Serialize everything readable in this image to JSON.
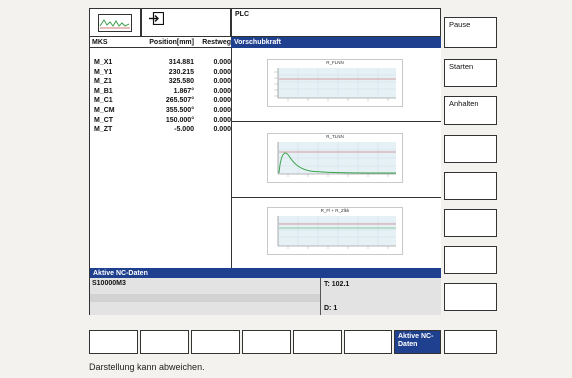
{
  "toolbar": {
    "wave_icon": "waveform-icon",
    "export_icon": "arrow-into-box-icon",
    "channel_label": "PLC"
  },
  "table": {
    "headers": [
      "MKS",
      "Position[mm]",
      "Restweg"
    ],
    "rows": [
      {
        "name": "M_X1",
        "position": "314.881",
        "rest": "0.000"
      },
      {
        "name": "M_Y1",
        "position": "230.215",
        "rest": "0.000"
      },
      {
        "name": "M_Z1",
        "position": "325.580",
        "rest": "0.000"
      },
      {
        "name": "M_B1",
        "position": "1.867°",
        "rest": "0.000"
      },
      {
        "name": "M_C1",
        "position": "265.507°",
        "rest": "0.000"
      },
      {
        "name": "M_CM",
        "position": "355.500°",
        "rest": "0.000"
      },
      {
        "name": "M_CT",
        "position": "150.000°",
        "rest": "0.000"
      },
      {
        "name": "M_ZT",
        "position": "-5.000",
        "rest": "0.000"
      }
    ]
  },
  "feed": {
    "header": "Vorschubkraft",
    "charts": [
      {
        "title": "R_FLNN"
      },
      {
        "title": "R_TLNN"
      },
      {
        "title": "R_Fl + R_Zlkk"
      }
    ]
  },
  "active_nc": {
    "header": "Aktive NC-Daten",
    "program": "S10000M3",
    "tool_label": "T: 102.1",
    "d_label": "D: 1"
  },
  "softkeys": {
    "right": [
      "Pause",
      "Starten",
      "Anhalten",
      "",
      "",
      "",
      "",
      ""
    ],
    "bottom": [
      "",
      "",
      "",
      "",
      "",
      "",
      "Aktive NC-Daten",
      ""
    ]
  },
  "footer_note": "Darstellung kann abweichen.",
  "colors": {
    "header_blue": "#1f3f8f",
    "chart_bg": "#e6f1f6",
    "curve_green": "#3aa24a",
    "curve_red": "#c0504d"
  }
}
